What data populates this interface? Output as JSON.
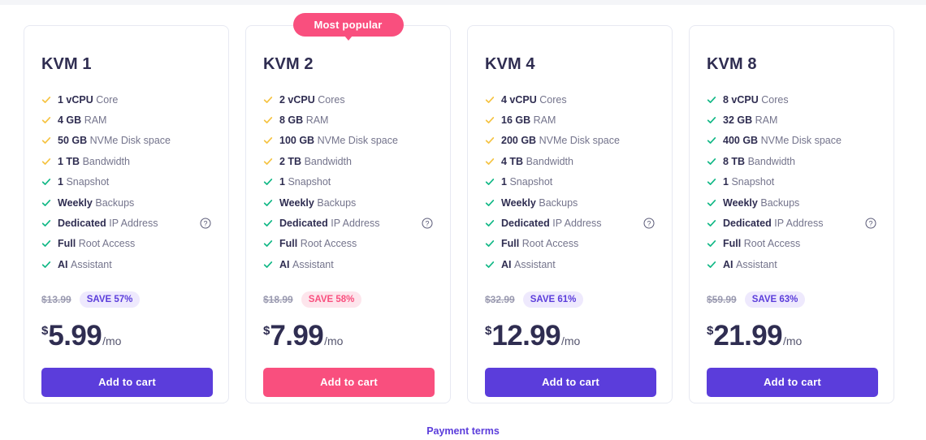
{
  "footer": {
    "payment_terms_label": "Payment terms"
  },
  "icons": {
    "check": "check-icon",
    "help": "help-circle-icon"
  },
  "colors": {
    "violet": "#5b3ddb",
    "pink": "#f94f7e",
    "amber_check": "#f5c342",
    "green_check": "#12b886",
    "title": "#2f2d51",
    "muted": "#74748c"
  },
  "plans": [
    {
      "name": "KVM 1",
      "popular": false,
      "accent": "violet",
      "features": [
        {
          "strong": "1 vCPU",
          "rest": "Core",
          "check": "amber",
          "help": false
        },
        {
          "strong": "4 GB",
          "rest": "RAM",
          "check": "amber",
          "help": false
        },
        {
          "strong": "50 GB",
          "rest": "NVMe Disk space",
          "check": "amber",
          "help": false
        },
        {
          "strong": "1 TB",
          "rest": "Bandwidth",
          "check": "amber",
          "help": false
        },
        {
          "strong": "1",
          "rest": "Snapshot",
          "check": "green",
          "help": false
        },
        {
          "strong": "Weekly",
          "rest": "Backups",
          "check": "green",
          "help": false
        },
        {
          "strong": "Dedicated",
          "rest": "IP Address",
          "check": "green",
          "help": true
        },
        {
          "strong": "Full",
          "rest": "Root Access",
          "check": "green",
          "help": false
        },
        {
          "strong": "AI",
          "rest": "Assistant",
          "check": "green",
          "help": false
        }
      ],
      "old_price": "$13.99",
      "save": "SAVE 57%",
      "currency": "$",
      "amount": "5.99",
      "per": "/mo",
      "cta": "Add to cart"
    },
    {
      "name": "KVM 2",
      "popular": true,
      "popular_label": "Most popular",
      "accent": "pink",
      "features": [
        {
          "strong": "2 vCPU",
          "rest": "Cores",
          "check": "amber",
          "help": false
        },
        {
          "strong": "8 GB",
          "rest": "RAM",
          "check": "amber",
          "help": false
        },
        {
          "strong": "100 GB",
          "rest": "NVMe Disk space",
          "check": "amber",
          "help": false
        },
        {
          "strong": "2 TB",
          "rest": "Bandwidth",
          "check": "amber",
          "help": false
        },
        {
          "strong": "1",
          "rest": "Snapshot",
          "check": "green",
          "help": false
        },
        {
          "strong": "Weekly",
          "rest": "Backups",
          "check": "green",
          "help": false
        },
        {
          "strong": "Dedicated",
          "rest": "IP Address",
          "check": "green",
          "help": true
        },
        {
          "strong": "Full",
          "rest": "Root Access",
          "check": "green",
          "help": false
        },
        {
          "strong": "AI",
          "rest": "Assistant",
          "check": "green",
          "help": false
        }
      ],
      "old_price": "$18.99",
      "save": "SAVE 58%",
      "currency": "$",
      "amount": "7.99",
      "per": "/mo",
      "cta": "Add to cart"
    },
    {
      "name": "KVM 4",
      "popular": false,
      "accent": "violet",
      "features": [
        {
          "strong": "4 vCPU",
          "rest": "Cores",
          "check": "amber",
          "help": false
        },
        {
          "strong": "16 GB",
          "rest": "RAM",
          "check": "amber",
          "help": false
        },
        {
          "strong": "200 GB",
          "rest": "NVMe Disk space",
          "check": "amber",
          "help": false
        },
        {
          "strong": "4 TB",
          "rest": "Bandwidth",
          "check": "amber",
          "help": false
        },
        {
          "strong": "1",
          "rest": "Snapshot",
          "check": "green",
          "help": false
        },
        {
          "strong": "Weekly",
          "rest": "Backups",
          "check": "green",
          "help": false
        },
        {
          "strong": "Dedicated",
          "rest": "IP Address",
          "check": "green",
          "help": true
        },
        {
          "strong": "Full",
          "rest": "Root Access",
          "check": "green",
          "help": false
        },
        {
          "strong": "AI",
          "rest": "Assistant",
          "check": "green",
          "help": false
        }
      ],
      "old_price": "$32.99",
      "save": "SAVE 61%",
      "currency": "$",
      "amount": "12.99",
      "per": "/mo",
      "cta": "Add to cart"
    },
    {
      "name": "KVM 8",
      "popular": false,
      "accent": "violet",
      "features": [
        {
          "strong": "8 vCPU",
          "rest": "Cores",
          "check": "green",
          "help": false
        },
        {
          "strong": "32 GB",
          "rest": "RAM",
          "check": "green",
          "help": false
        },
        {
          "strong": "400 GB",
          "rest": "NVMe Disk space",
          "check": "green",
          "help": false
        },
        {
          "strong": "8 TB",
          "rest": "Bandwidth",
          "check": "green",
          "help": false
        },
        {
          "strong": "1",
          "rest": "Snapshot",
          "check": "green",
          "help": false
        },
        {
          "strong": "Weekly",
          "rest": "Backups",
          "check": "green",
          "help": false
        },
        {
          "strong": "Dedicated",
          "rest": "IP Address",
          "check": "green",
          "help": true
        },
        {
          "strong": "Full",
          "rest": "Root Access",
          "check": "green",
          "help": false
        },
        {
          "strong": "AI",
          "rest": "Assistant",
          "check": "green",
          "help": false
        }
      ],
      "old_price": "$59.99",
      "save": "SAVE 63%",
      "currency": "$",
      "amount": "21.99",
      "per": "/mo",
      "cta": "Add to cart"
    }
  ]
}
